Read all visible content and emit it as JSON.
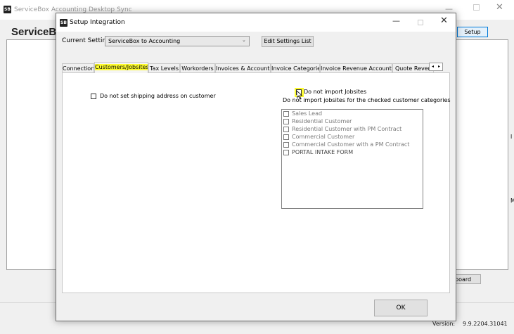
{
  "background_window": {
    "title": "ServiceBox Accounting Desktop Sync",
    "logo_text": "SB",
    "heading": "ServiceBo",
    "setup_button": "Setup",
    "partial_button": "board",
    "version_label": "Version:",
    "version_value": "9.9.2204.31041",
    "edge_letters": [
      "l",
      "M"
    ],
    "grip": "...",
    "controls": {
      "minimize": "—",
      "close": "✕"
    }
  },
  "dialog": {
    "title": "Setup Integration",
    "logo_text": "SB",
    "controls": {
      "minimize": "—",
      "close": "✕"
    },
    "current_settings_label": "Current Settings",
    "current_settings_value": "ServiceBox to Accounting",
    "chevron": "⌄",
    "edit_settings_button": "Edit Settings List",
    "tabs": [
      {
        "label": "Connection"
      },
      {
        "label": "Customers/Jobsites",
        "active": true,
        "highlighted": true
      },
      {
        "label": "Tax Levels"
      },
      {
        "label": "Workorders"
      },
      {
        "label": "Invoices & Accounts"
      },
      {
        "label": "Invoice Categories"
      },
      {
        "label": "Invoice Revenue Accounts"
      },
      {
        "label": "Quote Revenue"
      }
    ],
    "tab_scroll": {
      "left": "◂",
      "right": "▸"
    },
    "customers_tab": {
      "ship_address_checkbox": {
        "label": "Do not set shipping address on customer",
        "checked": false
      },
      "import_jobsites_checkbox": {
        "label": "Do not import Jobsites",
        "checked": false,
        "highlighted": true
      },
      "categories_note": "Do not import jobsites for the checked customer categories",
      "categories": [
        {
          "label": "Sales Lead",
          "checked": false
        },
        {
          "label": "Residential Customer",
          "checked": false
        },
        {
          "label": "Residential Customer with PM Contract",
          "checked": false
        },
        {
          "label": "Commercial Customer",
          "checked": false
        },
        {
          "label": "Commercial Customer with a PM Contract",
          "checked": false
        },
        {
          "label": "PORTAL INTAKE FORM",
          "checked": false
        }
      ]
    },
    "ok_button": "OK"
  },
  "colors": {
    "highlight": "#fdfb2f",
    "focus_border": "#0078d7"
  }
}
